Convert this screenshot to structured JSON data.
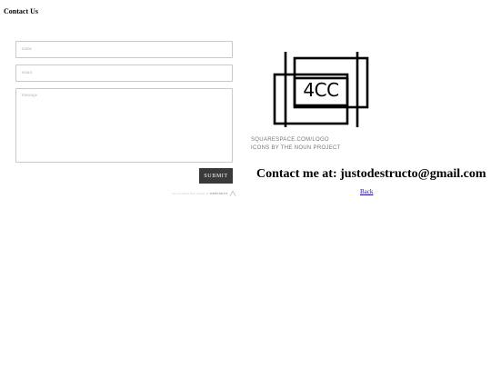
{
  "page": {
    "title": "Contact Us"
  },
  "form": {
    "name_placeholder": "name",
    "email_placeholder": "email",
    "message_placeholder": "message",
    "submit_label": "SUBMIT",
    "footer_text": "Get a Contact Box widget @",
    "footer_brand": "WEBLEKTT"
  },
  "logo": {
    "text": "4CC",
    "credit_line1": "SQUARESPACE.COM/LOGO",
    "credit_line2": "ICONS BY THE NOUN PROJECT"
  },
  "contact": {
    "heading": "Contact me at: justodestructo@gmail.com",
    "back_label": "Back"
  },
  "colors": {
    "submit_bg": "#3a3a3a",
    "link": "#1a0dab",
    "border": "#c9c9c9"
  }
}
